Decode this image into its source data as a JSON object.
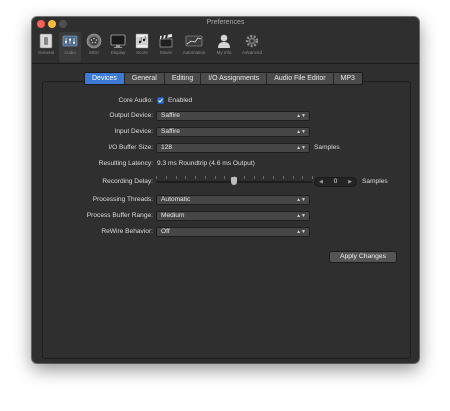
{
  "window": {
    "title": "Preferences",
    "traffic_lights": {
      "close": "#fc605b",
      "minimize": "#fdbc40",
      "zoom": "#4f4f4f"
    }
  },
  "toolbar": {
    "items": [
      {
        "label": "General",
        "icon": "general-switch-icon",
        "active": false
      },
      {
        "label": "Audio",
        "icon": "audio-mixer-icon",
        "active": true
      },
      {
        "label": "MIDI",
        "icon": "midi-port-icon",
        "active": false
      },
      {
        "label": "Display",
        "icon": "display-monitor-icon",
        "active": false
      },
      {
        "label": "Score",
        "icon": "score-sheet-icon",
        "active": false
      },
      {
        "label": "Movie",
        "icon": "movie-clapper-icon",
        "active": false
      },
      {
        "label": "Automation",
        "icon": "automation-icon",
        "active": false
      },
      {
        "label": "My Info",
        "icon": "person-silhouette-icon",
        "active": false
      },
      {
        "label": "Advanced",
        "icon": "gear-icon",
        "active": false
      }
    ]
  },
  "tabs": [
    {
      "label": "Devices",
      "active": true
    },
    {
      "label": "General",
      "active": false
    },
    {
      "label": "Editing",
      "active": false
    },
    {
      "label": "I/O Assignments",
      "active": false
    },
    {
      "label": "Audio File Editor",
      "active": false
    },
    {
      "label": "MP3",
      "active": false
    }
  ],
  "settings": {
    "core_audio": {
      "label": "Core Audio:",
      "checkbox_label": "Enabled",
      "checked": true
    },
    "output_device": {
      "label": "Output Device:",
      "value": "Saffire"
    },
    "input_device": {
      "label": "Input Device:",
      "value": "Saffire"
    },
    "io_buffer_size": {
      "label": "I/O Buffer Size:",
      "value": "128",
      "unit": "Samples"
    },
    "resulting_latency": {
      "label": "Resulting Latency:",
      "value": "9.3 ms Roundtrip (4.6 ms Output)"
    },
    "recording_delay": {
      "label": "Recording Delay:",
      "value": "0",
      "unit": "Samples",
      "slider_position": 0.5
    },
    "processing_threads": {
      "label": "Processing Threads:",
      "value": "Automatic"
    },
    "process_buffer_range": {
      "label": "Process Buffer Range:",
      "value": "Medium"
    },
    "rewire_behavior": {
      "label": "ReWire Behavior:",
      "value": "Off"
    }
  },
  "buttons": {
    "apply_changes": "Apply Changes"
  },
  "colors": {
    "window_bg": "#2f2f2f",
    "accent": "#3d7ad6",
    "text": "#dedede"
  }
}
